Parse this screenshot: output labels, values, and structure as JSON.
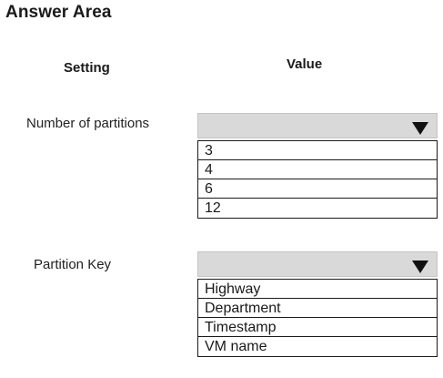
{
  "title": "Answer Area",
  "columns": {
    "setting": "Setting",
    "value": "Value"
  },
  "rows": [
    {
      "label": "Number of partitions",
      "options": [
        "3",
        "4",
        "6",
        "12"
      ]
    },
    {
      "label": "Partition Key",
      "options": [
        "Highway",
        "Department",
        "Timestamp",
        "VM name"
      ]
    }
  ],
  "icons": {
    "dropdown": "triangle-down-icon"
  },
  "colors": {
    "dropdown_header": "#d9d9d9",
    "border": "#1a1a1a",
    "arrow": "#111111"
  }
}
